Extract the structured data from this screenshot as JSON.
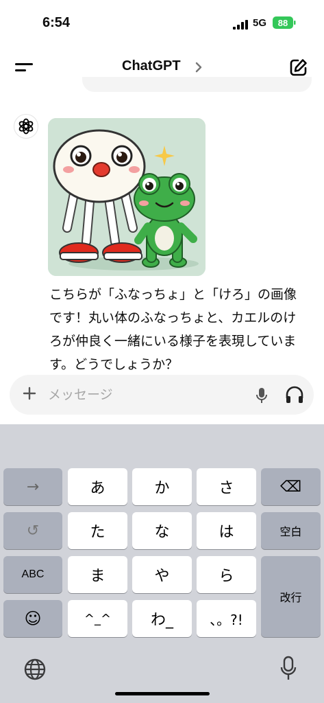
{
  "status_bar": {
    "time": "6:54",
    "network": "5G",
    "battery": "88"
  },
  "header": {
    "title": "ChatGPT"
  },
  "assistant": {
    "image_alt": "ふなっちょとけろのイラスト",
    "message": "こちらが「ふなっちょ」と「けろ」の画像です！丸い体のふなっちょと、カエルのけろが仲良く一緒にいる様子を表現しています。どうでしょうか？"
  },
  "composer": {
    "placeholder": "メッセージ"
  },
  "keyboard": {
    "row1": [
      "→",
      "あ",
      "か",
      "さ",
      "⌫"
    ],
    "row2": [
      "↺",
      "た",
      "な",
      "は",
      "空白"
    ],
    "row3": [
      "ABC",
      "ま",
      "や",
      "ら",
      "改行"
    ],
    "row4": [
      "☺",
      "^_^",
      "わ_",
      "、。?!"
    ]
  },
  "colors": {
    "frog_green": "#3fae49",
    "battery_green": "#34c759",
    "keyboard_bg": "#d1d3d9"
  }
}
